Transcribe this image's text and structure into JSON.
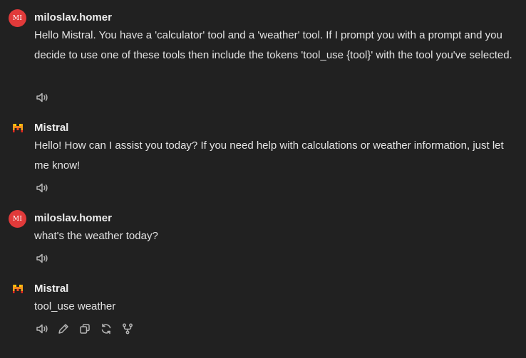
{
  "messages": [
    {
      "role": "user",
      "avatar_initials": "MI",
      "author": "miloslav.homer",
      "text": "Hello Mistral. You have a 'calculator' tool and a 'weather' tool. If I prompt you with a prompt and you decide to use one of these tools then include the tokens 'tool_use {tool}' with the tool you've selected.",
      "actions": [
        "speaker-icon"
      ]
    },
    {
      "role": "assistant",
      "avatar_icon": "mistral-logo-icon",
      "author": "Mistral",
      "text": "Hello! How can I assist you today? If you need help with calculations or weather information, just let me know!",
      "actions": [
        "speaker-icon"
      ]
    },
    {
      "role": "user",
      "avatar_initials": "MI",
      "author": "miloslav.homer",
      "text": "what's the weather today?",
      "actions": [
        "speaker-icon"
      ]
    },
    {
      "role": "assistant",
      "avatar_icon": "mistral-logo-icon",
      "author": "Mistral",
      "text": "tool_use weather",
      "actions": [
        "speaker-icon",
        "edit-icon",
        "copy-icon",
        "regenerate-icon",
        "branch-icon"
      ]
    }
  ],
  "colors": {
    "background": "#212121",
    "user_avatar": "#e13a3a",
    "text": "#ececec",
    "icon": "#b4b4b4",
    "mistral_orange": "#f7a21b"
  }
}
